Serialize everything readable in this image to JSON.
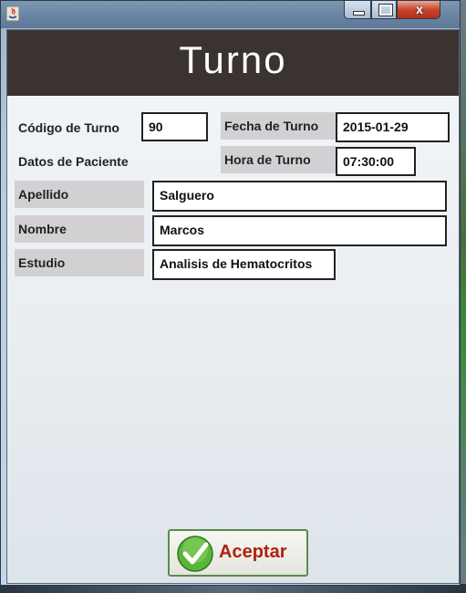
{
  "window": {
    "title": "",
    "close_glyph": "x",
    "icon": "java-icon"
  },
  "header": {
    "title": "Turno"
  },
  "form": {
    "codigo_label": "Código de Turno",
    "codigo_value": "90",
    "fecha_label": "Fecha de Turno",
    "fecha_value": "2015-01-29",
    "datos_label": "Datos de Paciente",
    "hora_label": "Hora de Turno",
    "hora_value": "07:30:00",
    "apellido_label": "Apellido",
    "apellido_value": "Salguero",
    "nombre_label": "Nombre",
    "nombre_value": "Marcos",
    "estudio_label": "Estudio",
    "estudio_value": "Analisis de Hematocritos"
  },
  "actions": {
    "accept_label": "Aceptar",
    "accept_icon": "check-icon"
  },
  "colors": {
    "header_bg": "#3b3330",
    "accept_text": "#b02010",
    "label_bg": "#d3d0d4"
  }
}
